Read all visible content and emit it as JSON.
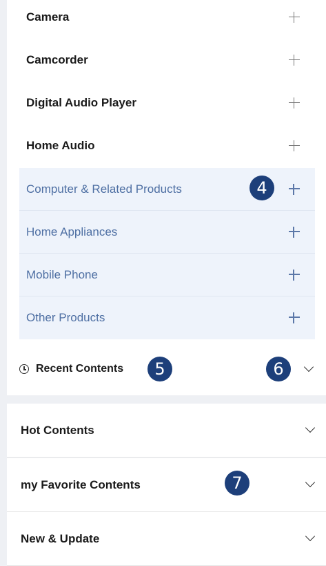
{
  "categories": [
    {
      "label": "Camera"
    },
    {
      "label": "Camcorder"
    },
    {
      "label": "Digital Audio Player"
    },
    {
      "label": "Home Audio"
    }
  ],
  "subcategories": [
    {
      "label": "Computer & Related Products"
    },
    {
      "label": "Home Appliances"
    },
    {
      "label": "Mobile Phone"
    },
    {
      "label": "Other Products"
    }
  ],
  "recent": {
    "label": "Recent Contents"
  },
  "sections": [
    {
      "label": "Hot Contents"
    },
    {
      "label": "my Favorite Contents"
    },
    {
      "label": "New & Update"
    }
  ],
  "badges": {
    "b4": "4",
    "b5": "5",
    "b6": "6",
    "b7": "7"
  }
}
